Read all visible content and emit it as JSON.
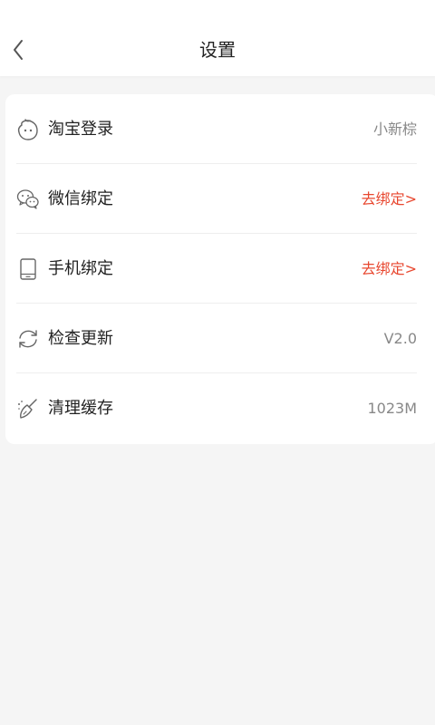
{
  "header": {
    "title": "设置",
    "back_icon": "chevron-left-icon"
  },
  "settings": {
    "items": [
      {
        "icon": "taobao-icon",
        "label": "淘宝登录",
        "value": "小新棕",
        "value_color": "#888888"
      },
      {
        "icon": "wechat-icon",
        "label": "微信绑定",
        "value": "去绑定>",
        "value_color": "#e8472f"
      },
      {
        "icon": "phone-icon",
        "label": "手机绑定",
        "value": "去绑定>",
        "value_color": "#e8472f"
      },
      {
        "icon": "refresh-icon",
        "label": "检查更新",
        "value": "V2.0",
        "value_color": "#888888"
      },
      {
        "icon": "broom-icon",
        "label": "清理缓存",
        "value": "1023M",
        "value_color": "#888888"
      }
    ]
  },
  "colors": {
    "background": "#f5f5f5",
    "accent": "#e8472f",
    "text": "#222222",
    "muted": "#888888"
  }
}
